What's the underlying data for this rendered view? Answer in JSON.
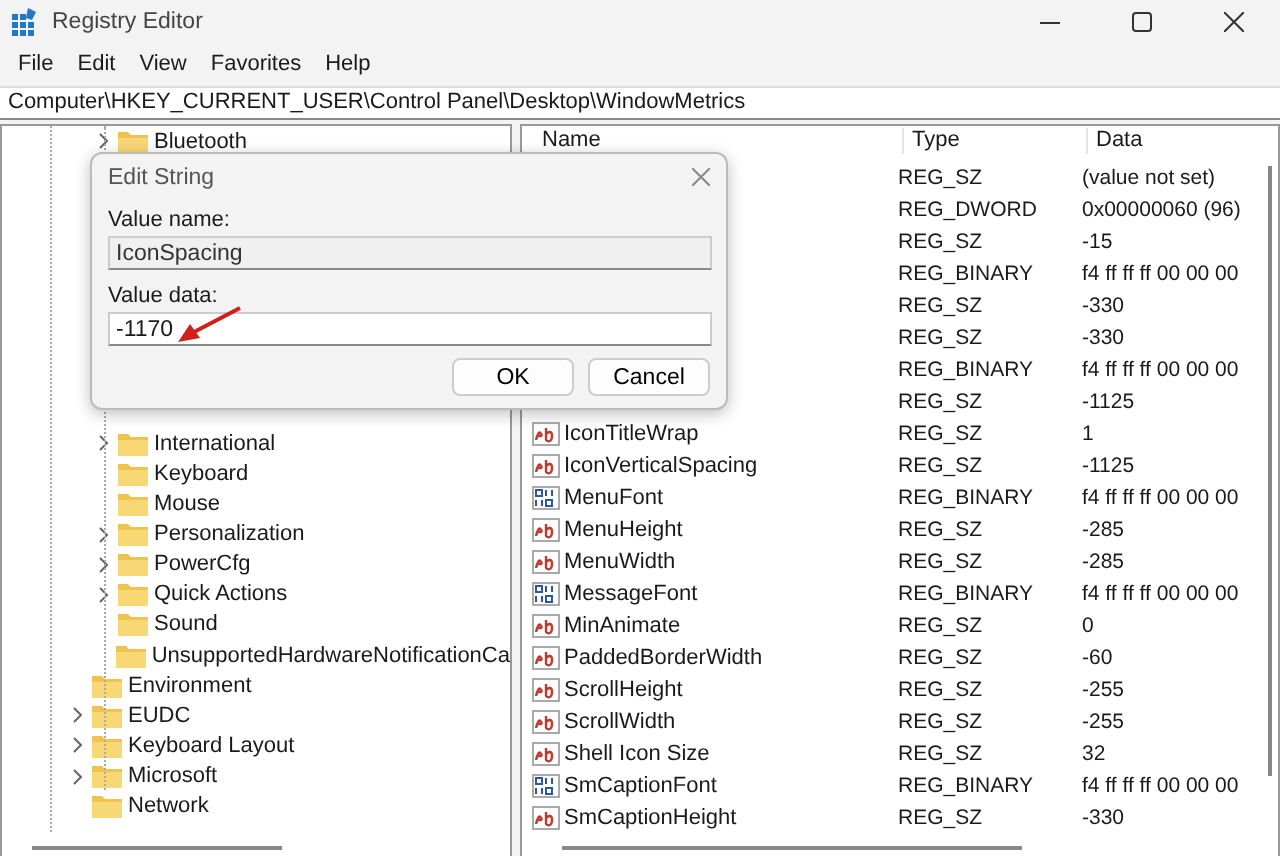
{
  "window": {
    "title": "Registry Editor"
  },
  "menu": [
    "File",
    "Edit",
    "View",
    "Favorites",
    "Help"
  ],
  "address": "Computer\\HKEY_CURRENT_USER\\Control Panel\\Desktop\\WindowMetrics",
  "tree": {
    "items": [
      {
        "children": [
          {
            "label": "Bluetooth",
            "expandable": true
          },
          {
            "label": "International",
            "expandable": true
          },
          {
            "label": "Keyboard",
            "expandable": false
          },
          {
            "label": "Mouse",
            "expandable": false
          },
          {
            "label": "Personalization",
            "expandable": true
          },
          {
            "label": "PowerCfg",
            "expandable": true
          },
          {
            "label": "Quick Actions",
            "expandable": true
          },
          {
            "label": "Sound",
            "expandable": false
          },
          {
            "label": "UnsupportedHardwareNotificationCa",
            "expandable": false
          }
        ]
      },
      {
        "label": "Environment",
        "expandable": false
      },
      {
        "label": "EUDC",
        "expandable": true
      },
      {
        "label": "Keyboard Layout",
        "expandable": true
      },
      {
        "label": "Microsoft",
        "expandable": true
      },
      {
        "label": "Network",
        "expandable": false
      }
    ]
  },
  "table": {
    "columns": [
      "Name",
      "Type",
      "Data"
    ],
    "rows": [
      {
        "type": "REG_SZ",
        "data": "(value not set)"
      },
      {
        "type": "REG_DWORD",
        "data": "0x00000060 (96)"
      },
      {
        "type": "REG_SZ",
        "data": "-15"
      },
      {
        "type": "REG_BINARY",
        "data": "f4 ff ff ff 00 00 00"
      },
      {
        "type": "REG_SZ",
        "data": "-330"
      },
      {
        "type": "REG_SZ",
        "data": "-330"
      },
      {
        "type": "REG_BINARY",
        "data": "f4 ff ff ff 00 00 00"
      },
      {
        "type": "REG_SZ",
        "data": "-1125"
      },
      {
        "kind": "string",
        "name": "IconTitleWrap",
        "type": "REG_SZ",
        "data": "1"
      },
      {
        "kind": "string",
        "name": "IconVerticalSpacing",
        "type": "REG_SZ",
        "data": "-1125"
      },
      {
        "kind": "binary",
        "name": "MenuFont",
        "type": "REG_BINARY",
        "data": "f4 ff ff ff 00 00 00"
      },
      {
        "kind": "string",
        "name": "MenuHeight",
        "type": "REG_SZ",
        "data": "-285"
      },
      {
        "kind": "string",
        "name": "MenuWidth",
        "type": "REG_SZ",
        "data": "-285"
      },
      {
        "kind": "binary",
        "name": "MessageFont",
        "type": "REG_BINARY",
        "data": "f4 ff ff ff 00 00 00"
      },
      {
        "kind": "string",
        "name": "MinAnimate",
        "type": "REG_SZ",
        "data": "0"
      },
      {
        "kind": "string",
        "name": "PaddedBorderWidth",
        "type": "REG_SZ",
        "data": "-60"
      },
      {
        "kind": "string",
        "name": "ScrollHeight",
        "type": "REG_SZ",
        "data": "-255"
      },
      {
        "kind": "string",
        "name": "ScrollWidth",
        "type": "REG_SZ",
        "data": "-255"
      },
      {
        "kind": "string",
        "name": "Shell Icon Size",
        "type": "REG_SZ",
        "data": "32"
      },
      {
        "kind": "binary",
        "name": "SmCaptionFont",
        "type": "REG_BINARY",
        "data": "f4 ff ff ff 00 00 00"
      },
      {
        "kind": "string",
        "name": "SmCaptionHeight",
        "type": "REG_SZ",
        "data": "-330"
      }
    ]
  },
  "dialog": {
    "title": "Edit String",
    "value_name_label": "Value name:",
    "value_name": "IconSpacing",
    "value_data_label": "Value data:",
    "value_data": "-1170",
    "buttons": [
      "OK",
      "Cancel"
    ]
  }
}
